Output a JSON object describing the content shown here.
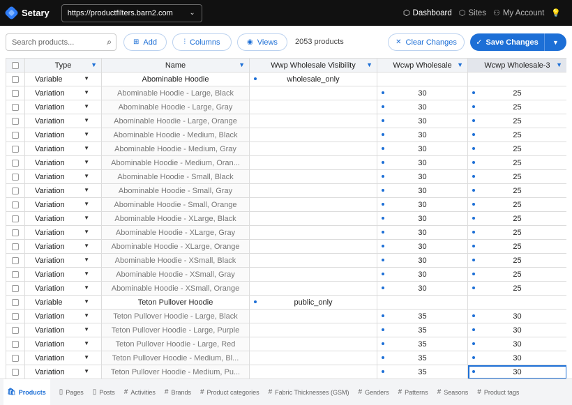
{
  "app": {
    "name": "Setary",
    "site_url": "https://productfilters.barn2.com"
  },
  "topnav": [
    {
      "label": "Dashboard",
      "icon": "cube-icon",
      "glyph": "⬡",
      "active": true
    },
    {
      "label": "Sites",
      "icon": "cubes-icon",
      "glyph": "⬡",
      "active": false
    },
    {
      "label": "My Account",
      "icon": "user-icon",
      "glyph": "⚇",
      "active": false
    },
    {
      "label": "",
      "icon": "lightbulb-icon",
      "glyph": "💡",
      "active": false
    }
  ],
  "toolbar": {
    "search_placeholder": "Search products...",
    "add_label": "Add",
    "columns_label": "Columns",
    "views_label": "Views",
    "product_count": "2053 products",
    "clear_label": "Clear Changes",
    "save_label": "Save Changes"
  },
  "columns": [
    "Type",
    "Name",
    "Wwp Wholesale Visibility",
    "Wcwp Wholesale",
    "Wcwp Wholesale-3"
  ],
  "rows": [
    {
      "type": "Variable",
      "name": "Abominable Hoodie",
      "visibility": "wholesale_only",
      "wholesale": "",
      "wholesale3": ""
    },
    {
      "type": "Variation",
      "name": "Abominable Hoodie - Large, Black",
      "visibility": "",
      "wholesale": "30",
      "wholesale3": "25"
    },
    {
      "type": "Variation",
      "name": "Abominable Hoodie - Large, Gray",
      "visibility": "",
      "wholesale": "30",
      "wholesale3": "25"
    },
    {
      "type": "Variation",
      "name": "Abominable Hoodie - Large, Orange",
      "visibility": "",
      "wholesale": "30",
      "wholesale3": "25"
    },
    {
      "type": "Variation",
      "name": "Abominable Hoodie - Medium, Black",
      "visibility": "",
      "wholesale": "30",
      "wholesale3": "25"
    },
    {
      "type": "Variation",
      "name": "Abominable Hoodie - Medium, Gray",
      "visibility": "",
      "wholesale": "30",
      "wholesale3": "25"
    },
    {
      "type": "Variation",
      "name": "Abominable Hoodie - Medium, Oran...",
      "visibility": "",
      "wholesale": "30",
      "wholesale3": "25"
    },
    {
      "type": "Variation",
      "name": "Abominable Hoodie - Small, Black",
      "visibility": "",
      "wholesale": "30",
      "wholesale3": "25"
    },
    {
      "type": "Variation",
      "name": "Abominable Hoodie - Small, Gray",
      "visibility": "",
      "wholesale": "30",
      "wholesale3": "25"
    },
    {
      "type": "Variation",
      "name": "Abominable Hoodie - Small, Orange",
      "visibility": "",
      "wholesale": "30",
      "wholesale3": "25"
    },
    {
      "type": "Variation",
      "name": "Abominable Hoodie - XLarge, Black",
      "visibility": "",
      "wholesale": "30",
      "wholesale3": "25"
    },
    {
      "type": "Variation",
      "name": "Abominable Hoodie - XLarge, Gray",
      "visibility": "",
      "wholesale": "30",
      "wholesale3": "25"
    },
    {
      "type": "Variation",
      "name": "Abominable Hoodie - XLarge, Orange",
      "visibility": "",
      "wholesale": "30",
      "wholesale3": "25"
    },
    {
      "type": "Variation",
      "name": "Abominable Hoodie - XSmall, Black",
      "visibility": "",
      "wholesale": "30",
      "wholesale3": "25"
    },
    {
      "type": "Variation",
      "name": "Abominable Hoodie - XSmall, Gray",
      "visibility": "",
      "wholesale": "30",
      "wholesale3": "25"
    },
    {
      "type": "Variation",
      "name": "Abominable Hoodie - XSmall, Orange",
      "visibility": "",
      "wholesale": "30",
      "wholesale3": "25"
    },
    {
      "type": "Variable",
      "name": "Teton Pullover Hoodie",
      "visibility": "public_only",
      "wholesale": "",
      "wholesale3": ""
    },
    {
      "type": "Variation",
      "name": "Teton Pullover Hoodie - Large, Black",
      "visibility": "",
      "wholesale": "35",
      "wholesale3": "30"
    },
    {
      "type": "Variation",
      "name": "Teton Pullover Hoodie - Large, Purple",
      "visibility": "",
      "wholesale": "35",
      "wholesale3": "30"
    },
    {
      "type": "Variation",
      "name": "Teton Pullover Hoodie - Large, Red",
      "visibility": "",
      "wholesale": "35",
      "wholesale3": "30"
    },
    {
      "type": "Variation",
      "name": "Teton Pullover Hoodie - Medium, Bl...",
      "visibility": "",
      "wholesale": "35",
      "wholesale3": "30"
    },
    {
      "type": "Variation",
      "name": "Teton Pullover Hoodie - Medium, Pu...",
      "visibility": "",
      "wholesale": "35",
      "wholesale3": "30"
    }
  ],
  "tabs": [
    {
      "label": "Products",
      "icon": "shopping-bag-icon",
      "glyph": "🛍",
      "active": true
    },
    {
      "label": "Pages",
      "icon": "page-icon",
      "glyph": "▯",
      "active": false
    },
    {
      "label": "Posts",
      "icon": "page-icon",
      "glyph": "▯",
      "active": false
    },
    {
      "label": "Activities",
      "icon": "hash-icon",
      "glyph": "#",
      "active": false
    },
    {
      "label": "Brands",
      "icon": "hash-icon",
      "glyph": "#",
      "active": false
    },
    {
      "label": "Product categories",
      "icon": "hash-icon",
      "glyph": "#",
      "active": false
    },
    {
      "label": "Fabric Thicknesses (GSM)",
      "icon": "hash-icon",
      "glyph": "#",
      "active": false
    },
    {
      "label": "Genders",
      "icon": "hash-icon",
      "glyph": "#",
      "active": false
    },
    {
      "label": "Patterns",
      "icon": "hash-icon",
      "glyph": "#",
      "active": false
    },
    {
      "label": "Seasons",
      "icon": "hash-icon",
      "glyph": "#",
      "active": false
    },
    {
      "label": "Product tags",
      "icon": "hash-icon",
      "glyph": "#",
      "active": false
    }
  ],
  "colors": {
    "accent": "#1d6fd6",
    "topbar": "#111111"
  }
}
